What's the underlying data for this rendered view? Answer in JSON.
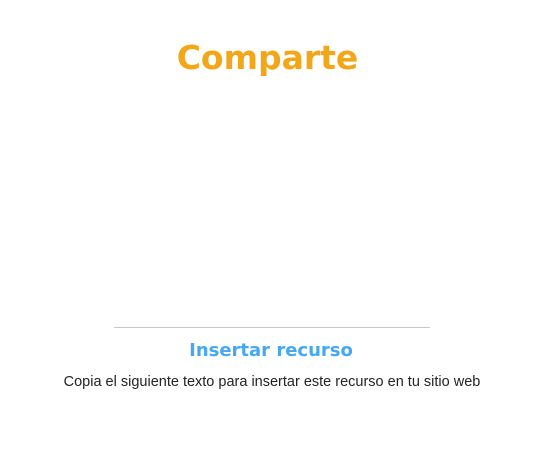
{
  "share": {
    "title": "Comparte"
  },
  "embed": {
    "title": "Insertar recurso",
    "instructions": "Copia el siguiente texto para insertar este recurso en tu sitio web"
  },
  "colors": {
    "title": "#f2a71b",
    "subtitle": "#46a8f0",
    "divider": "#c8c8c8",
    "text": "#222222"
  }
}
